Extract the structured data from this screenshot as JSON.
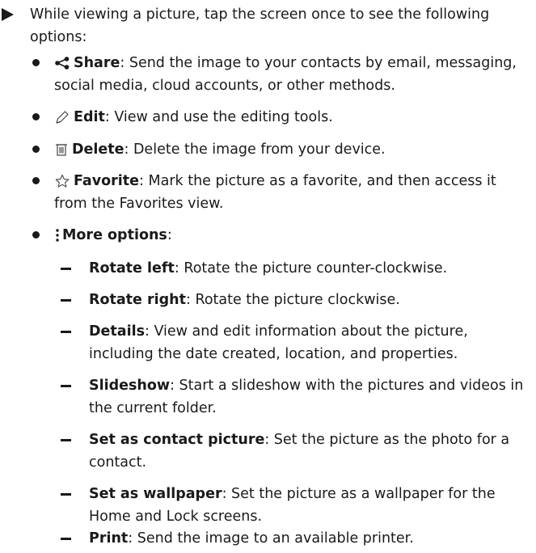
{
  "intro": "While viewing a picture, tap the screen once to see the following options:",
  "options": [
    {
      "icon": "share-icon",
      "term": "Share",
      "desc": ": Send the image to your contacts by email, messaging, social media, cloud accounts, or other methods."
    },
    {
      "icon": "edit-icon",
      "term": "Edit",
      "desc": ": View and use the editing tools."
    },
    {
      "icon": "trash-icon",
      "term": "Delete",
      "desc": ": Delete the image from your device."
    },
    {
      "icon": "star-icon",
      "term": "Favorite",
      "desc": ": Mark the picture as a favorite, and then access it from the Favorites view."
    },
    {
      "icon": "more-options-icon",
      "term": "More options",
      "desc": ":"
    }
  ],
  "more_options": [
    {
      "term": "Rotate left",
      "desc": ": Rotate the picture counter-clockwise."
    },
    {
      "term": "Rotate right",
      "desc": ": Rotate the picture clockwise."
    },
    {
      "term": "Details",
      "desc": ": View and edit information about the picture, including the date created, location, and properties."
    },
    {
      "term": "Slideshow",
      "desc": ": Start a slideshow with the pictures and videos in the current folder."
    },
    {
      "term": "Set as contact picture",
      "desc": ": Set the picture as the photo for a contact."
    },
    {
      "term": "Set as wallpaper",
      "desc": ": Set the picture as a wallpaper for the Home and Lock screens."
    },
    {
      "term": "Print",
      "desc": ": Send the image to an available printer."
    }
  ]
}
